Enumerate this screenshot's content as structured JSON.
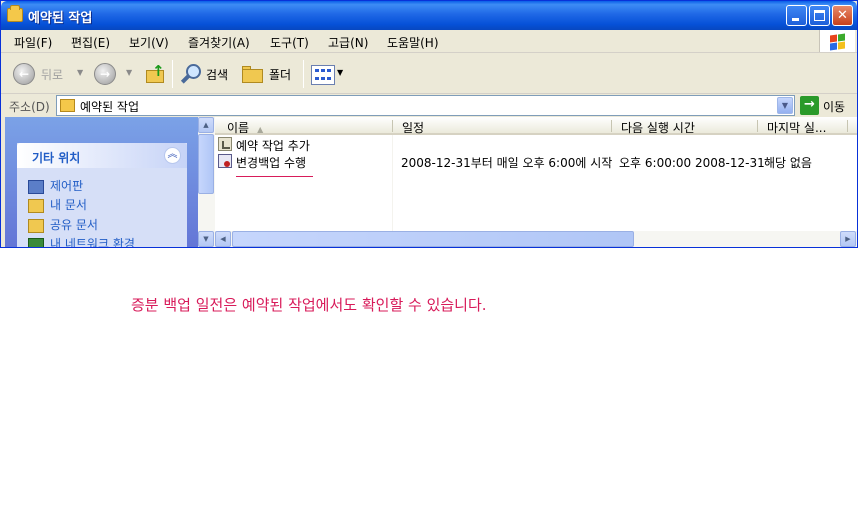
{
  "window": {
    "title": "예약된 작업"
  },
  "titlebar": {
    "close_glyph": "✕"
  },
  "menu": [
    "파일(F)",
    "편집(E)",
    "보기(V)",
    "즐겨찾기(A)",
    "도구(T)",
    "고급(N)",
    "도움말(H)"
  ],
  "toolbar": {
    "back": "뒤로",
    "search": "검색",
    "folders": "폴더"
  },
  "address": {
    "label": "주소(D)",
    "value": "예약된 작업",
    "go": "이동"
  },
  "sidebar": {
    "section_title": "기타 위치",
    "items": [
      "제어판",
      "내 문서",
      "공유 문서",
      "내 네트워크 환경"
    ]
  },
  "list": {
    "columns": [
      "이름",
      "일정",
      "다음 실행 시간",
      "마지막 실..."
    ],
    "rows": [
      {
        "name": "예약 작업 추가",
        "schedule": "",
        "next_run": "",
        "last_run": ""
      },
      {
        "name": "변경백업 수행",
        "schedule": "2008-12-31부터 매일 오후 6:00에 시작",
        "next_run": "오후 6:00:00  2008-12-31",
        "last_run": "해당 없음"
      }
    ]
  },
  "caption": "증분 백업 일전은 예약된 작업에서도 확인할 수 있습니다.",
  "colors": {
    "accent_caption": "#d81b5a",
    "title_bar": "#0a5ee8"
  }
}
